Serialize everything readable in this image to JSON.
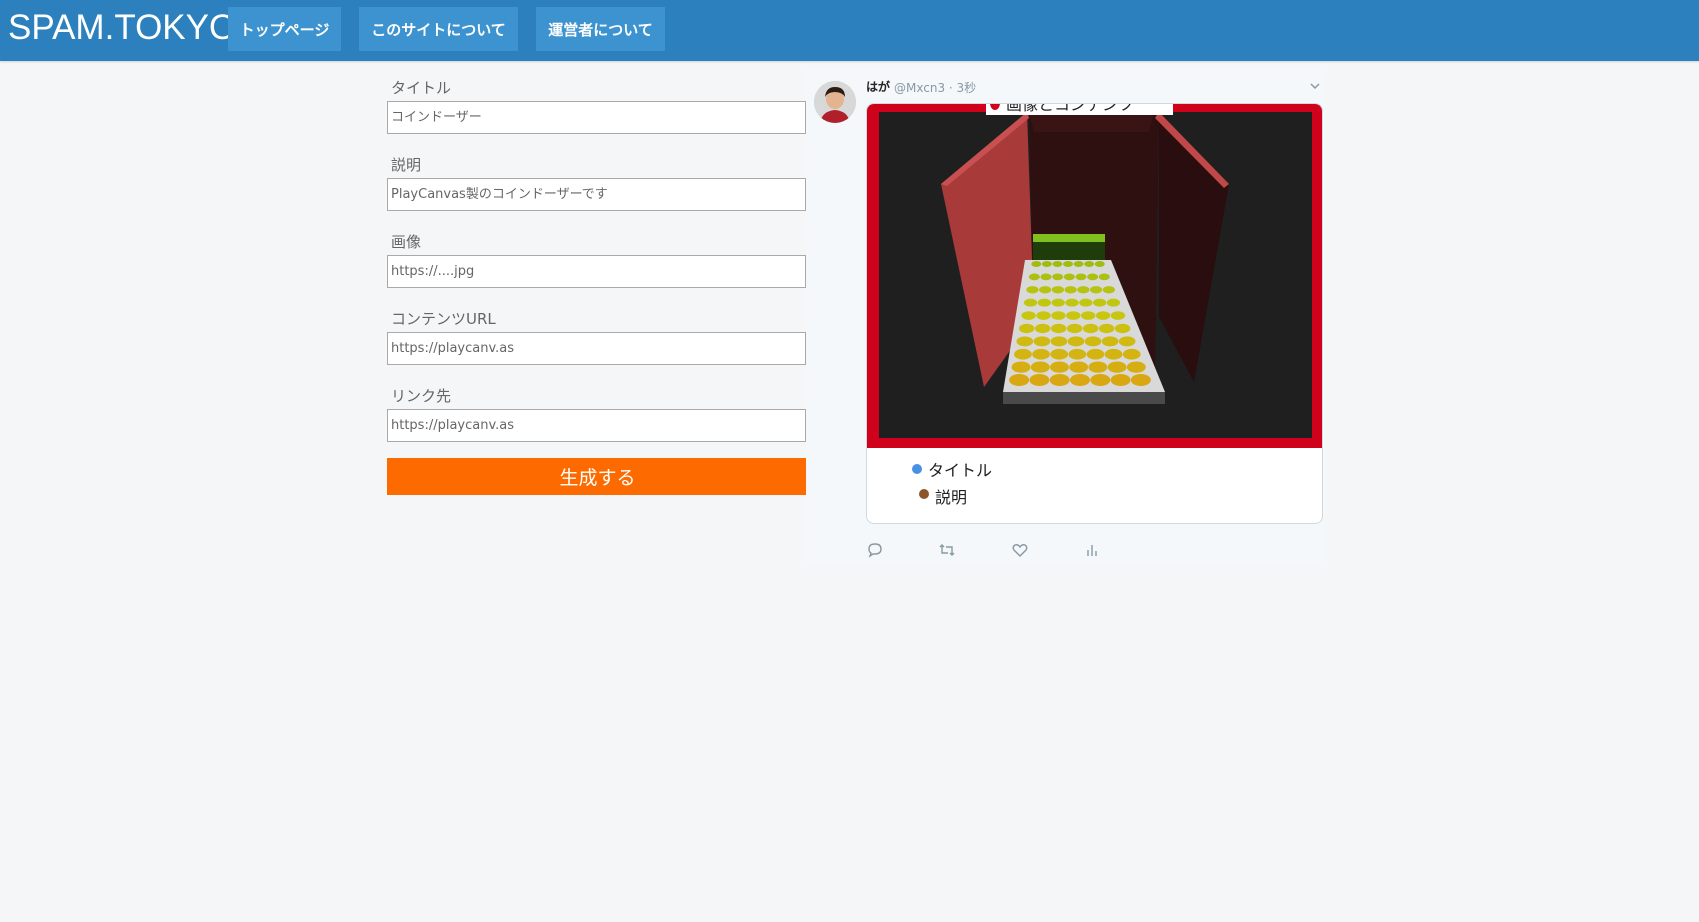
{
  "header": {
    "brand": "SPAM.TOKYO",
    "nav": [
      {
        "label": "トップページ"
      },
      {
        "label": "このサイトについて"
      },
      {
        "label": "運営者について"
      }
    ]
  },
  "form": {
    "title": {
      "label": "タイトル",
      "placeholder": "コインドーザー"
    },
    "description": {
      "label": "説明",
      "placeholder": "PlayCanvas製のコインドーザーです"
    },
    "image": {
      "label": "画像",
      "placeholder": "https://....jpg"
    },
    "content_url": {
      "label": "コンテンツURL",
      "placeholder": "https://playcanv.as"
    },
    "link": {
      "label": "リンク先",
      "placeholder": "https://playcanv.as"
    },
    "submit_label": "生成する"
  },
  "tweet": {
    "name": "はが",
    "handle": "@Mxcn3 · 3秒",
    "legend_image": "画像とコンテンツ",
    "legend_title": "タイトル",
    "legend_description": "説明",
    "colors": {
      "image_border": "#d0021b",
      "title_dot": "#4a90e2",
      "description_dot": "#8b572a"
    },
    "actions": [
      "reply-icon",
      "retweet-icon",
      "like-icon",
      "analytics-icon"
    ]
  },
  "colors": {
    "header": "#2b80bd",
    "nav_button": "#3d93cf",
    "generate_button": "#fd6b00"
  }
}
